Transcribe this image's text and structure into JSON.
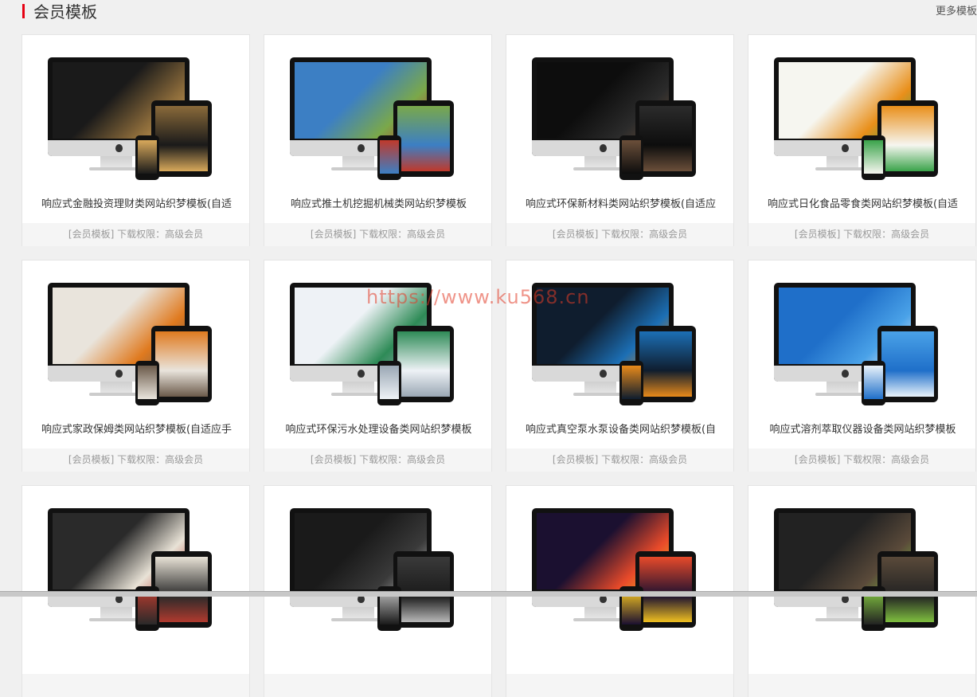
{
  "header": {
    "title": "会员模板",
    "more_label": "更多模板"
  },
  "watermark": "https://www.ku568.cn",
  "cards": [
    {
      "title": "响应式金融投资理财类网站织梦模板(自适",
      "meta": "[会员模板] 下载权限：高级会员",
      "theme": [
        "#1a1a1a",
        "#8a6a3a",
        "#d9a95b"
      ]
    },
    {
      "title": "响应式推土机挖掘机械类网站织梦模板",
      "meta": "[会员模板] 下载权限：高级会员",
      "theme": [
        "#3c7fc4",
        "#7aa84a",
        "#c0392b"
      ]
    },
    {
      "title": "响应式环保新材料类网站织梦模板(自适应",
      "meta": "[会员模板] 下载权限：高级会员",
      "theme": [
        "#0d0d0d",
        "#2b2b2b",
        "#6b4f3a"
      ]
    },
    {
      "title": "响应式日化食品零食类网站织梦模板(自适",
      "meta": "[会员模板] 下载权限：高级会员",
      "theme": [
        "#f6f6f0",
        "#e98f1a",
        "#3aa34a"
      ]
    },
    {
      "title": "响应式家政保姆类网站织梦模板(自适应手",
      "meta": "[会员模板] 下载权限：高级会员",
      "theme": [
        "#e9e4dc",
        "#e07a1f",
        "#6b5a4a"
      ]
    },
    {
      "title": "响应式环保污水处理设备类网站织梦模板",
      "meta": "[会员模板] 下载权限：高级会员",
      "theme": [
        "#eef2f6",
        "#2e8b57",
        "#9aa7b4"
      ]
    },
    {
      "title": "响应式真空泵水泵设备类网站织梦模板(自",
      "meta": "[会员模板] 下载权限：高级会员",
      "theme": [
        "#0f1d2e",
        "#1c6fb5",
        "#e88a1a"
      ]
    },
    {
      "title": "响应式溶剂萃取仪器设备类网站织梦模板",
      "meta": "[会员模板] 下载权限：高级会员",
      "theme": [
        "#1f6fc9",
        "#4aa2e8",
        "#eaf3fb"
      ]
    },
    {
      "title": "",
      "meta": "",
      "theme": [
        "#2a2a2a",
        "#e8e2d6",
        "#b03a2e"
      ]
    },
    {
      "title": "",
      "meta": "",
      "theme": [
        "#1a1a1a",
        "#3a3a3a",
        "#b8b8b8"
      ]
    },
    {
      "title": "",
      "meta": "",
      "theme": [
        "#1b1030",
        "#e84a2a",
        "#f0c020"
      ]
    },
    {
      "title": "",
      "meta": "",
      "theme": [
        "#222222",
        "#5a4a3a",
        "#7fbf3f"
      ]
    }
  ]
}
